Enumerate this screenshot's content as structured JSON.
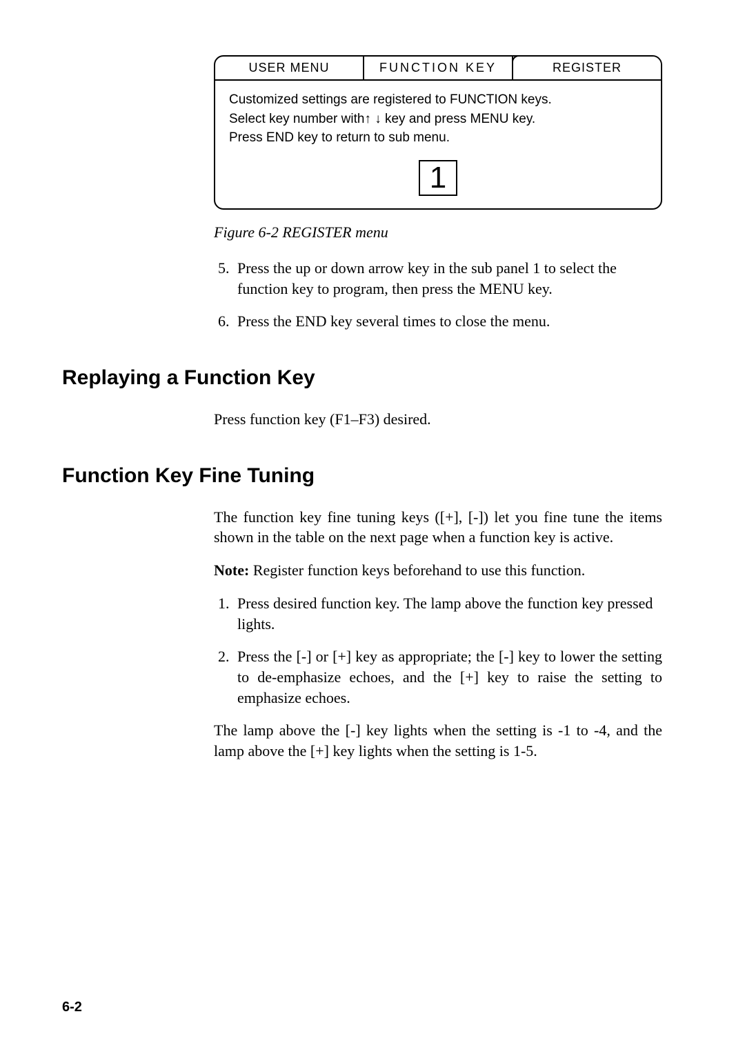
{
  "menu_panel": {
    "tabs": {
      "user_menu": "USER MENU",
      "function_key": "FUNCTION  KEY",
      "register": "REGISTER"
    },
    "body_line1": "Customized settings are registered to FUNCTION keys.",
    "body_line2_prefix": "Select key number with",
    "body_line2_suffix": " key and press MENU key.",
    "body_line3": "Press END key to return to sub menu.",
    "selected_number": "1"
  },
  "figure_caption": "Figure 6-2 REGISTER menu",
  "steps_continued": [
    {
      "num": "5.",
      "text": "Press the up or down arrow key in the sub panel 1 to select the function key to program, then press the MENU key."
    },
    {
      "num": "6.",
      "text": "Press the END key several times to close the menu."
    }
  ],
  "section_replay": {
    "heading": "Replaying a Function Key",
    "body": "Press function key (F1–F3) desired."
  },
  "section_finetune": {
    "heading": "Function Key Fine Tuning",
    "para1": "The function key fine tuning keys ([+], [-]) let you fine tune the items shown in the table on the next page when a function key is active.",
    "note_label": "Note:",
    "note_text": "  Register function keys beforehand to use this function.",
    "steps": [
      "Press desired function key. The lamp above the function key pressed lights.",
      "Press the [-] or [+] key as appropriate; the [-] key to lower the setting to de-emphasize echoes, and the [+] key to raise the setting to emphasize echoes."
    ],
    "para_last": "The lamp above the [-] key lights when the setting is -1 to -4, and the lamp above the [+] key lights when the setting is 1-5."
  },
  "page_number": "6-2"
}
